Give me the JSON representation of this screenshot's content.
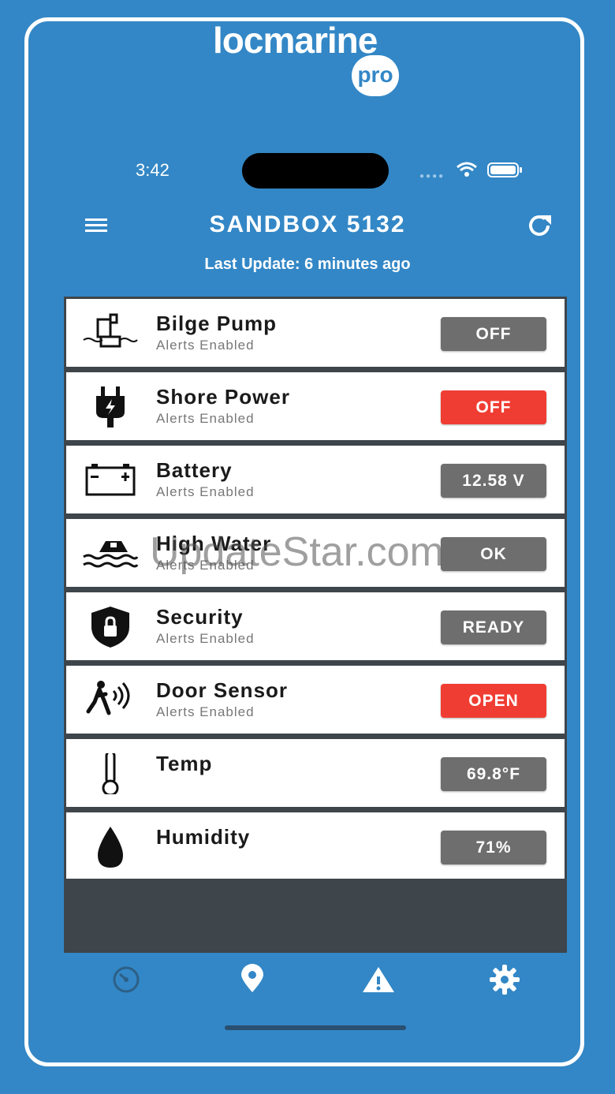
{
  "brand": {
    "name": "locmarine",
    "badge": "pro"
  },
  "status_bar": {
    "time": "3:42"
  },
  "header": {
    "title": "SANDBOX  5132",
    "last_update": "Last Update: 6 minutes ago"
  },
  "rows": [
    {
      "title": "Bilge Pump",
      "subtitle": "Alerts Enabled",
      "value": "OFF",
      "icon": "bilge-pump-icon",
      "alert": false
    },
    {
      "title": "Shore Power",
      "subtitle": "Alerts Enabled",
      "value": "OFF",
      "icon": "plug-icon",
      "alert": true
    },
    {
      "title": "Battery",
      "subtitle": "Alerts Enabled",
      "value": "12.58 V",
      "icon": "battery-icon",
      "alert": false
    },
    {
      "title": "High Water",
      "subtitle": "Alerts Enabled",
      "value": "OK",
      "icon": "high-water-icon",
      "alert": false
    },
    {
      "title": "Security",
      "subtitle": "Alerts Enabled",
      "value": "READY",
      "icon": "shield-lock-icon",
      "alert": false
    },
    {
      "title": "Door Sensor",
      "subtitle": "Alerts Enabled",
      "value": "OPEN",
      "icon": "motion-sensor-icon",
      "alert": true
    },
    {
      "title": "Temp",
      "subtitle": "",
      "value": "69.8°F",
      "icon": "thermometer-icon",
      "alert": false
    },
    {
      "title": "Humidity",
      "subtitle": "",
      "value": "71%",
      "icon": "drop-icon",
      "alert": false
    }
  ],
  "watermark": "UpdateStar.com",
  "tabs": [
    "dashboard-icon",
    "location-pin-icon",
    "warning-icon",
    "gear-icon"
  ],
  "colors": {
    "background": "#3387c6",
    "alert": "#f03d33",
    "neutral": "#6e6e6e"
  }
}
